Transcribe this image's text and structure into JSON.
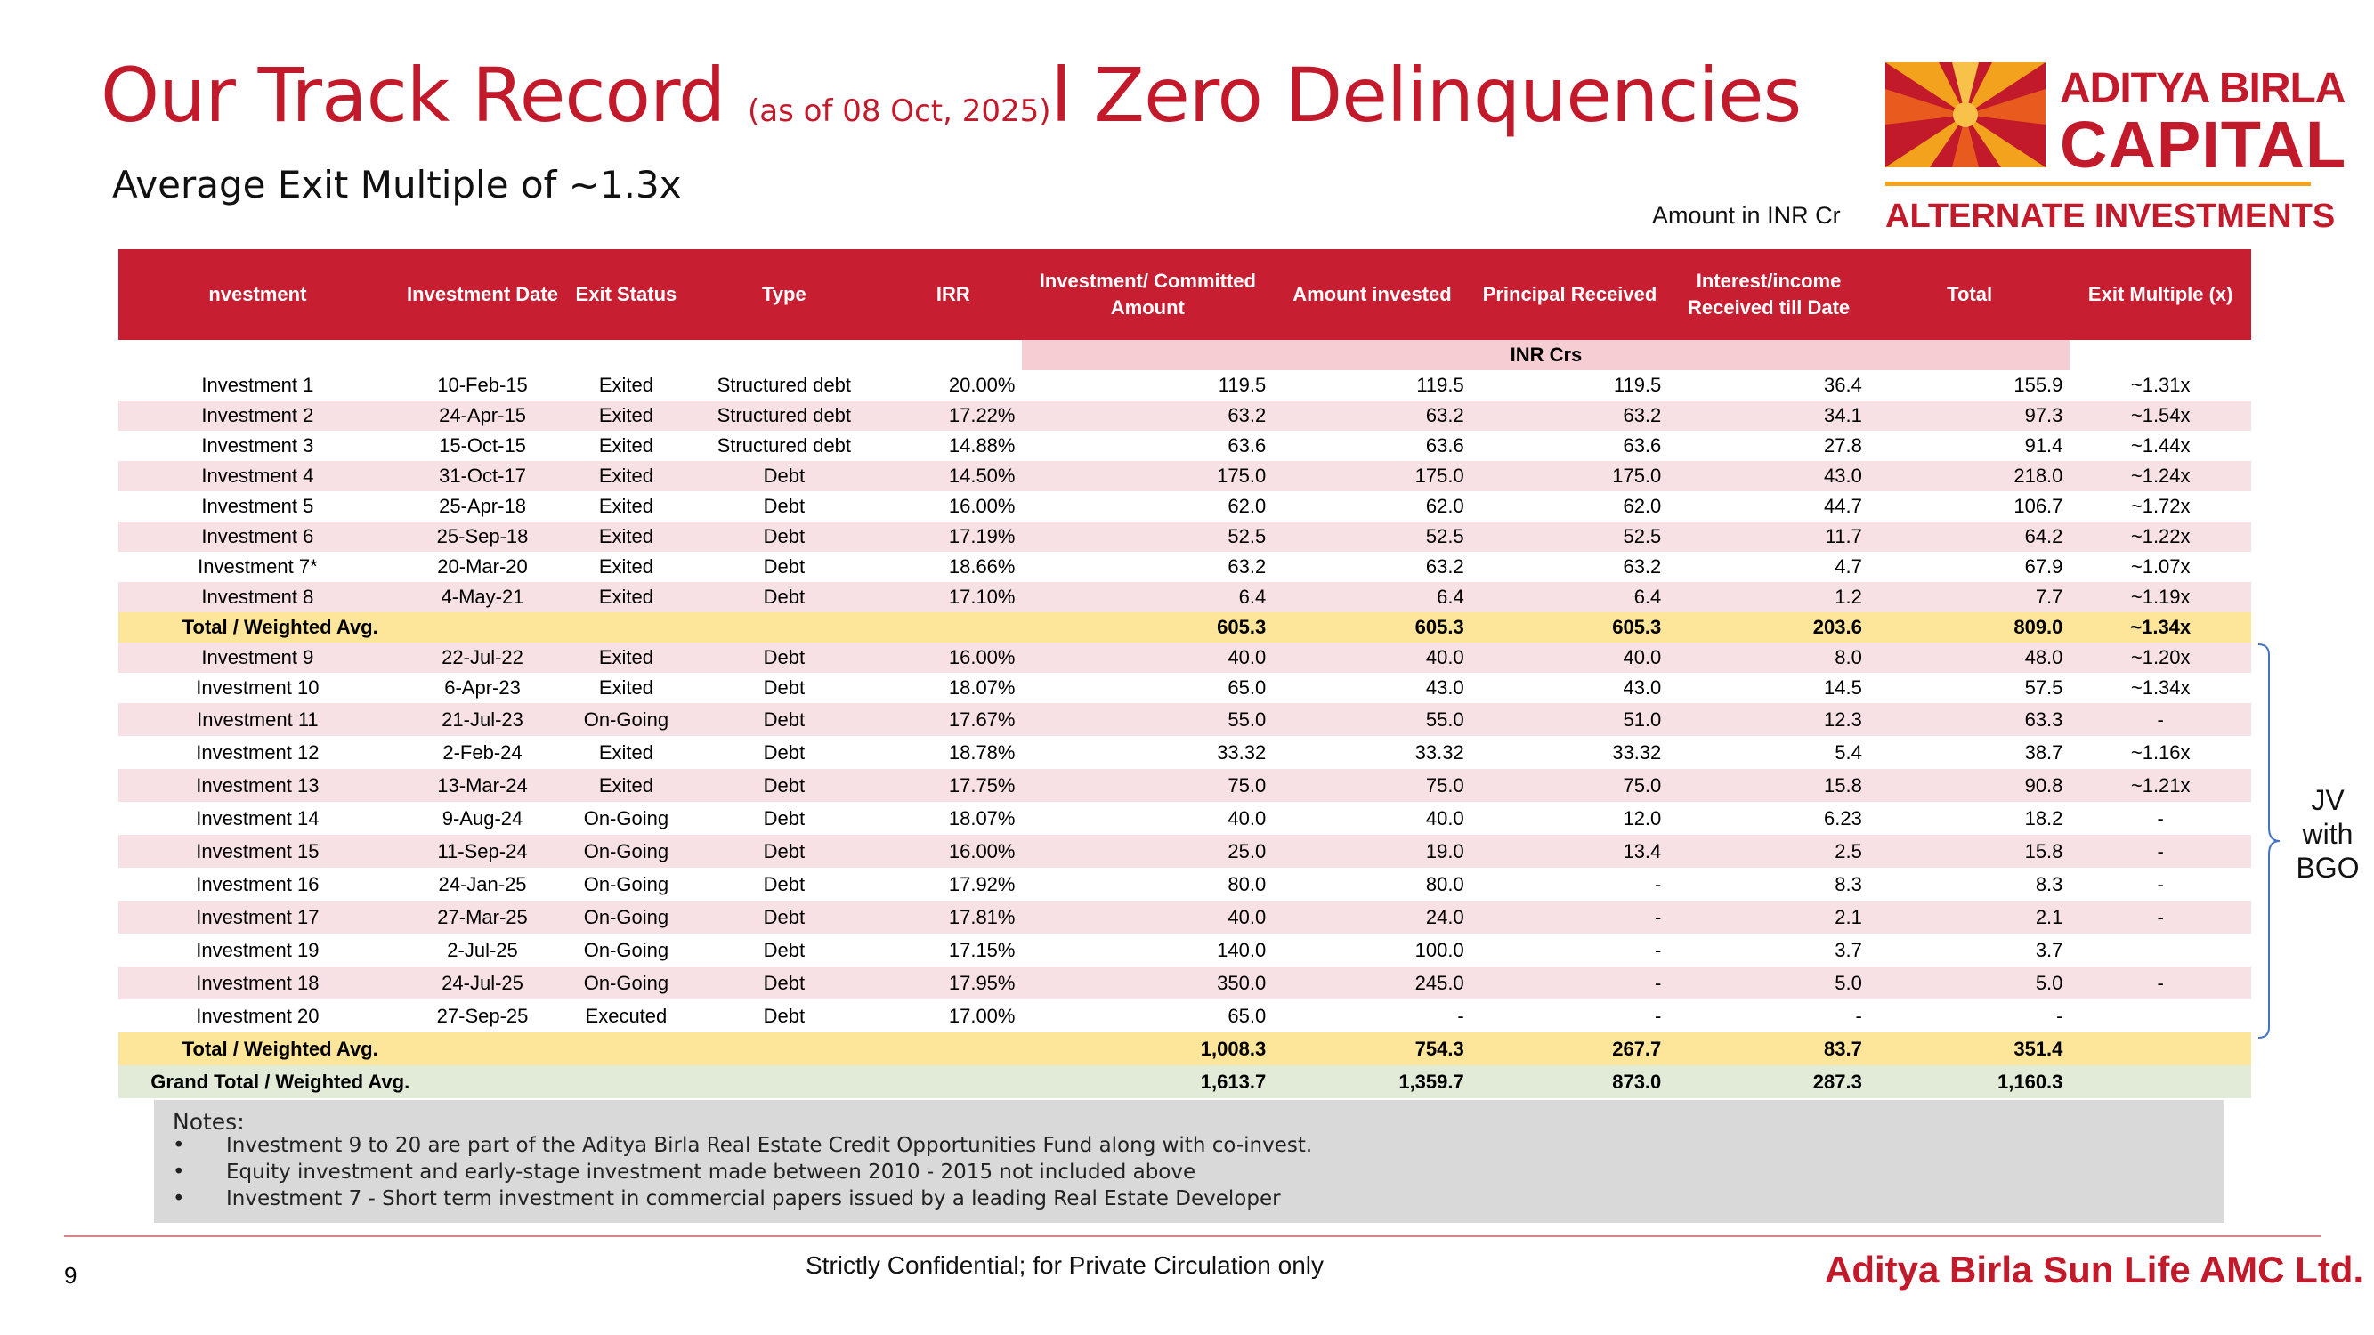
{
  "header": {
    "title_main": "Our Track Record ",
    "title_sub": "(as of 08 Oct, 2025)",
    "title_tail": "l Zero Delinquencies",
    "subtitle": "Average Exit Multiple of ~1.3x",
    "unit_note": "Amount in INR Cr"
  },
  "logo": {
    "line1": "ADITYA BIRLA",
    "line2": "CAPITAL",
    "line3": "ALTERNATE INVESTMENTS",
    "colors": {
      "red": "#c21a2b",
      "gold": "#f2a21d"
    }
  },
  "table": {
    "headers": [
      "nvestment",
      "Investment Date",
      "Exit Status",
      "Type",
      "IRR",
      "Investment/ Committed Amount",
      "Amount invested",
      "Principal Received",
      "Interest/income Received till Date",
      "Total",
      "Exit Multiple (x)"
    ],
    "unit_label": "INR Crs",
    "group1": [
      [
        "Investment 1",
        "10-Feb-15",
        "Exited",
        "Structured debt",
        "20.00%",
        "119.5",
        "119.5",
        "119.5",
        "36.4",
        "155.9",
        "~1.31x"
      ],
      [
        "Investment 2",
        "24-Apr-15",
        "Exited",
        "Structured debt",
        "17.22%",
        "63.2",
        "63.2",
        "63.2",
        "34.1",
        "97.3",
        "~1.54x"
      ],
      [
        "Investment 3",
        "15-Oct-15",
        "Exited",
        "Structured debt",
        "14.88%",
        "63.6",
        "63.6",
        "63.6",
        "27.8",
        "91.4",
        "~1.44x"
      ],
      [
        "Investment 4",
        "31-Oct-17",
        "Exited",
        "Debt",
        "14.50%",
        "175.0",
        "175.0",
        "175.0",
        "43.0",
        "218.0",
        "~1.24x"
      ],
      [
        "Investment 5",
        "25-Apr-18",
        "Exited",
        "Debt",
        "16.00%",
        "62.0",
        "62.0",
        "62.0",
        "44.7",
        "106.7",
        "~1.72x"
      ],
      [
        "Investment 6",
        "25-Sep-18",
        "Exited",
        "Debt",
        "17.19%",
        "52.5",
        "52.5",
        "52.5",
        "11.7",
        "64.2",
        "~1.22x"
      ],
      [
        "Investment 7*",
        "20-Mar-20",
        "Exited",
        "Debt",
        "18.66%",
        "63.2",
        "63.2",
        "63.2",
        "4.7",
        "67.9",
        "~1.07x"
      ],
      [
        "Investment 8",
        "4-May-21",
        "Exited",
        "Debt",
        "17.10%",
        "6.4",
        "6.4",
        "6.4",
        "1.2",
        "7.7",
        "~1.19x"
      ]
    ],
    "total1": {
      "label": "Total / Weighted Avg.",
      "committed": "605.3",
      "invested": "605.3",
      "principal": "605.3",
      "interest": "203.6",
      "total": "809.0",
      "multiple": "~1.34x"
    },
    "group2": [
      [
        "Investment 9",
        "22-Jul-22",
        "Exited",
        "Debt",
        "16.00%",
        "40.0",
        "40.0",
        "40.0",
        "8.0",
        "48.0",
        "~1.20x"
      ],
      [
        "Investment 10",
        "6-Apr-23",
        "Exited",
        "Debt",
        "18.07%",
        "65.0",
        "43.0",
        "43.0",
        "14.5",
        "57.5",
        "~1.34x"
      ],
      [
        "Investment 11",
        "21-Jul-23",
        "On-Going",
        "Debt",
        "17.67%",
        "55.0",
        "55.0",
        "51.0",
        "12.3",
        "63.3",
        "-"
      ],
      [
        "Investment 12",
        "2-Feb-24",
        "Exited",
        "Debt",
        "18.78%",
        "33.32",
        "33.32",
        "33.32",
        "5.4",
        "38.7",
        "~1.16x"
      ],
      [
        "Investment 13",
        "13-Mar-24",
        "Exited",
        "Debt",
        "17.75%",
        "75.0",
        "75.0",
        "75.0",
        "15.8",
        "90.8",
        "~1.21x"
      ],
      [
        "Investment 14",
        "9-Aug-24",
        "On-Going",
        "Debt",
        "18.07%",
        "40.0",
        "40.0",
        "12.0",
        "6.23",
        "18.2",
        "-"
      ],
      [
        "Investment 15",
        "11-Sep-24",
        "On-Going",
        "Debt",
        "16.00%",
        "25.0",
        "19.0",
        "13.4",
        "2.5",
        "15.8",
        "-"
      ],
      [
        "Investment 16",
        "24-Jan-25",
        "On-Going",
        "Debt",
        "17.92%",
        "80.0",
        "80.0",
        "-",
        "8.3",
        "8.3",
        "-"
      ],
      [
        "Investment 17",
        "27-Mar-25",
        "On-Going",
        "Debt",
        "17.81%",
        "40.0",
        "24.0",
        "-",
        "2.1",
        "2.1",
        "-"
      ],
      [
        "Investment 19",
        "2-Jul-25",
        "On-Going",
        "Debt",
        "17.15%",
        "140.0",
        "100.0",
        "-",
        "3.7",
        "3.7",
        ""
      ],
      [
        "Investment 18",
        "24-Jul-25",
        "On-Going",
        "Debt",
        "17.95%",
        "350.0",
        "245.0",
        "-",
        "5.0",
        "5.0",
        "-"
      ],
      [
        "Investment 20",
        "27-Sep-25",
        "Executed",
        "Debt",
        "17.00%",
        "65.0",
        "-",
        "-",
        "-",
        "-",
        ""
      ]
    ],
    "total2": {
      "label": "Total / Weighted Avg.",
      "committed": "1,008.3",
      "invested": "754.3",
      "principal": "267.7",
      "interest": "83.7",
      "total": "351.4",
      "multiple": ""
    },
    "grand": {
      "label": "Grand Total / Weighted Avg.",
      "committed": "1,613.7",
      "invested": "1,359.7",
      "principal": "873.0",
      "interest": "287.3",
      "total": "1,160.3",
      "multiple": ""
    }
  },
  "brace_label": {
    "line1": "JV",
    "line2": "with",
    "line3": "BGO"
  },
  "notes": {
    "heading": "Notes:",
    "bullet": "•",
    "items": [
      "Investment 9 to 20 are part of the Aditya Birla Real Estate Credit Opportunities Fund along with co-invest.",
      "Equity investment and early-stage investment made between 2010 - 2015 not included above",
      "Investment 7 - Short term investment in commercial papers issued by a leading Real Estate Developer"
    ]
  },
  "footer": {
    "page_number": "9",
    "confidential": "Strictly Confidential; for Private Circulation only",
    "company": "Aditya Birla Sun Life AMC Ltd."
  }
}
